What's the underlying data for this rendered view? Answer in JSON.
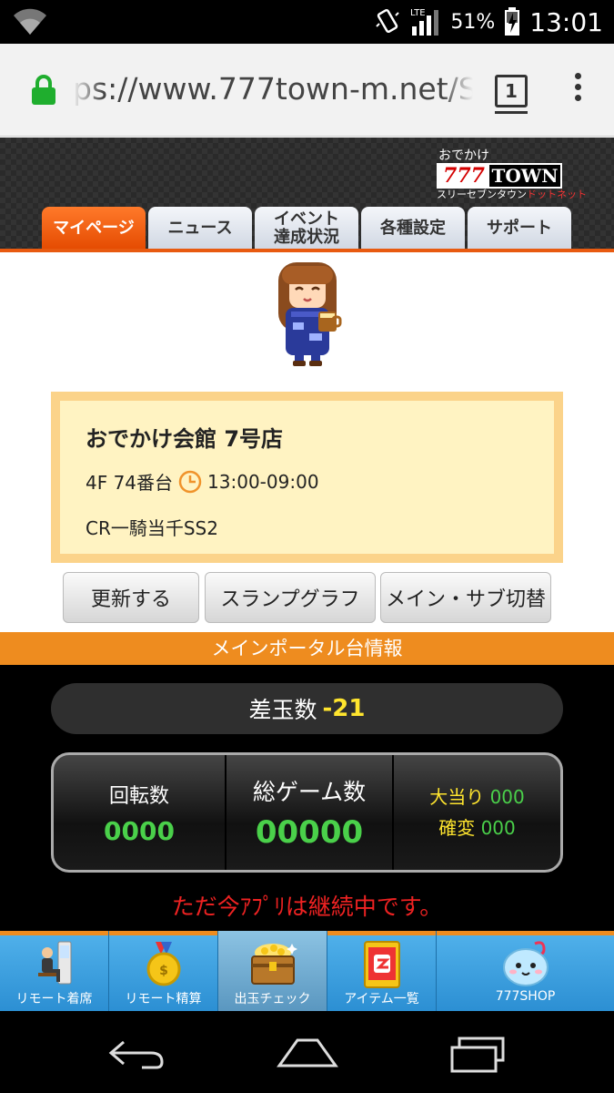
{
  "status_bar": {
    "network": "LTE",
    "battery": "51%",
    "time": "13:01"
  },
  "browser": {
    "url": "ps://www.777town-m.net/SP",
    "tab_count": "1"
  },
  "header": {
    "logo_top": "おでかけ",
    "logo_777": "777",
    "logo_town": "TOWN",
    "logo_sub_a": "スリーセブンタウン",
    "logo_sub_b": "ドットネット",
    "tabs": [
      {
        "label": "マイページ",
        "active": true
      },
      {
        "label": "ニュース",
        "active": false
      },
      {
        "label": "イベント\n達成状況",
        "active": false
      },
      {
        "label": "各種設定",
        "active": false
      },
      {
        "label": "サポート",
        "active": false
      }
    ]
  },
  "info": {
    "shop_name": "おでかけ会館 7号店",
    "floor_machine": "4F 74番台",
    "hours": "13:00-09:00",
    "machine_name": "CR一騎当千SS2"
  },
  "buttons": {
    "refresh": "更新する",
    "slump_graph": "スランプグラフ",
    "main_sub_switch": "メイン・サブ切替"
  },
  "portal": {
    "title": "メインポータル台情報",
    "diff_label": "差玉数",
    "diff_value": "-21",
    "spins_label": "回転数",
    "spins_value": "0000",
    "total_games_label": "総ゲーム数",
    "total_games_value": "00000",
    "jackpot_label": "大当り",
    "jackpot_value": "000",
    "kakuhen_label": "確変",
    "kakuhen_value": "000",
    "status_message": "ただ今ｱﾌﾟﾘは継続中です。"
  },
  "bottom_nav": [
    {
      "label": "リモート着席",
      "icon": "remote-seat-icon",
      "active": false
    },
    {
      "label": "リモート精算",
      "icon": "medal-icon",
      "active": false
    },
    {
      "label": "出玉チェック",
      "icon": "treasure-chest-icon",
      "active": true
    },
    {
      "label": "アイテム一覧",
      "icon": "item-card-icon",
      "active": false
    },
    {
      "label": "777SHOP",
      "icon": "mascot-icon",
      "active": false
    }
  ],
  "colors": {
    "accent_orange": "#ee8c1f",
    "tab_active": "#e44a00",
    "info_bg": "#fff3c2",
    "info_border": "#fbd38a",
    "stat_green": "#4ad04a",
    "stat_yellow": "#ffe52e",
    "message_red": "#ee2222",
    "nav_blue": "#2c8fd3"
  }
}
